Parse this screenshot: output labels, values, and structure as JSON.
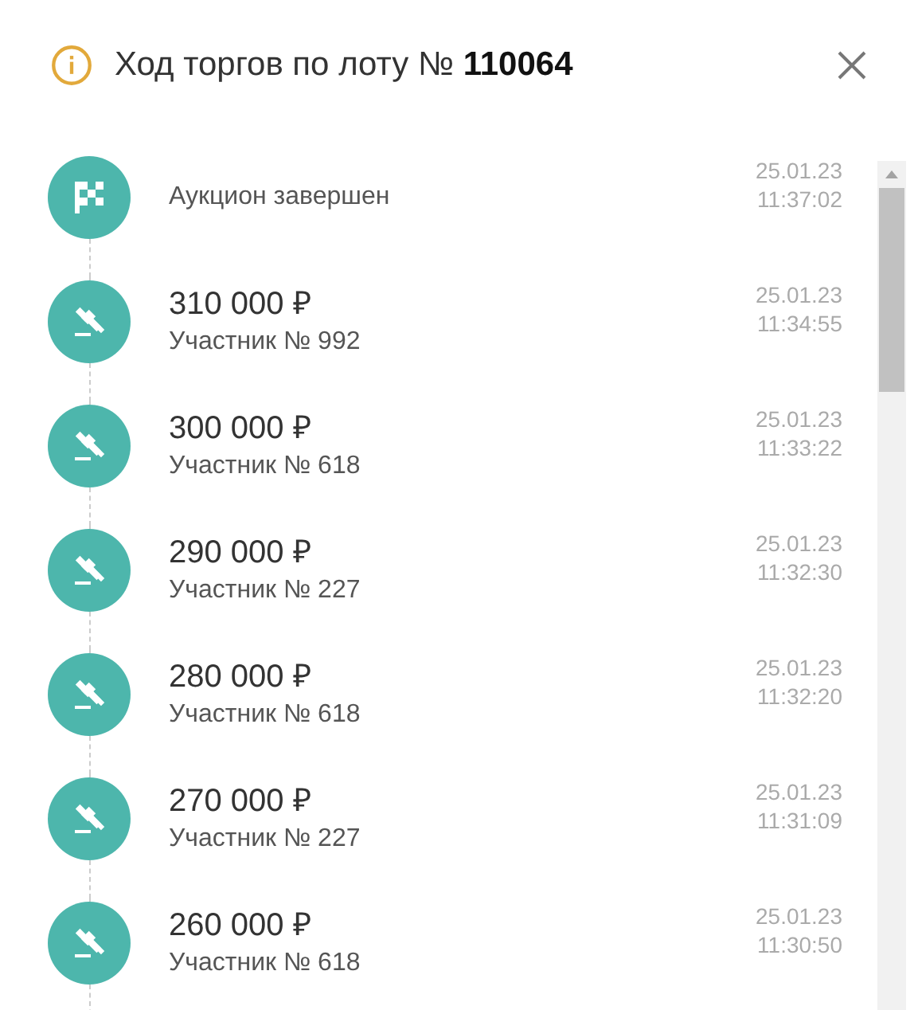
{
  "dialog": {
    "title": "Ход торгов по лоту № **110064**"
  },
  "events": [
    {
      "kind": "finish",
      "label": "Аукцион завершен",
      "date": "25.01.23",
      "time": "11:37:02"
    },
    {
      "kind": "bid",
      "amount": "310 000 ₽",
      "participant": "Участник № 992",
      "date": "25.01.23",
      "time": "11:34:55"
    },
    {
      "kind": "bid",
      "amount": "300 000 ₽",
      "participant": "Участник № 618",
      "date": "25.01.23",
      "time": "11:33:22"
    },
    {
      "kind": "bid",
      "amount": "290 000 ₽",
      "participant": "Участник № 227",
      "date": "25.01.23",
      "time": "11:32:30"
    },
    {
      "kind": "bid",
      "amount": "280 000 ₽",
      "participant": "Участник № 618",
      "date": "25.01.23",
      "time": "11:32:20"
    },
    {
      "kind": "bid",
      "amount": "270 000 ₽",
      "participant": "Участник № 227",
      "date": "25.01.23",
      "time": "11:31:09"
    },
    {
      "kind": "bid",
      "amount": "260 000 ₽",
      "participant": "Участник № 618",
      "date": "25.01.23",
      "time": "11:30:50"
    }
  ]
}
